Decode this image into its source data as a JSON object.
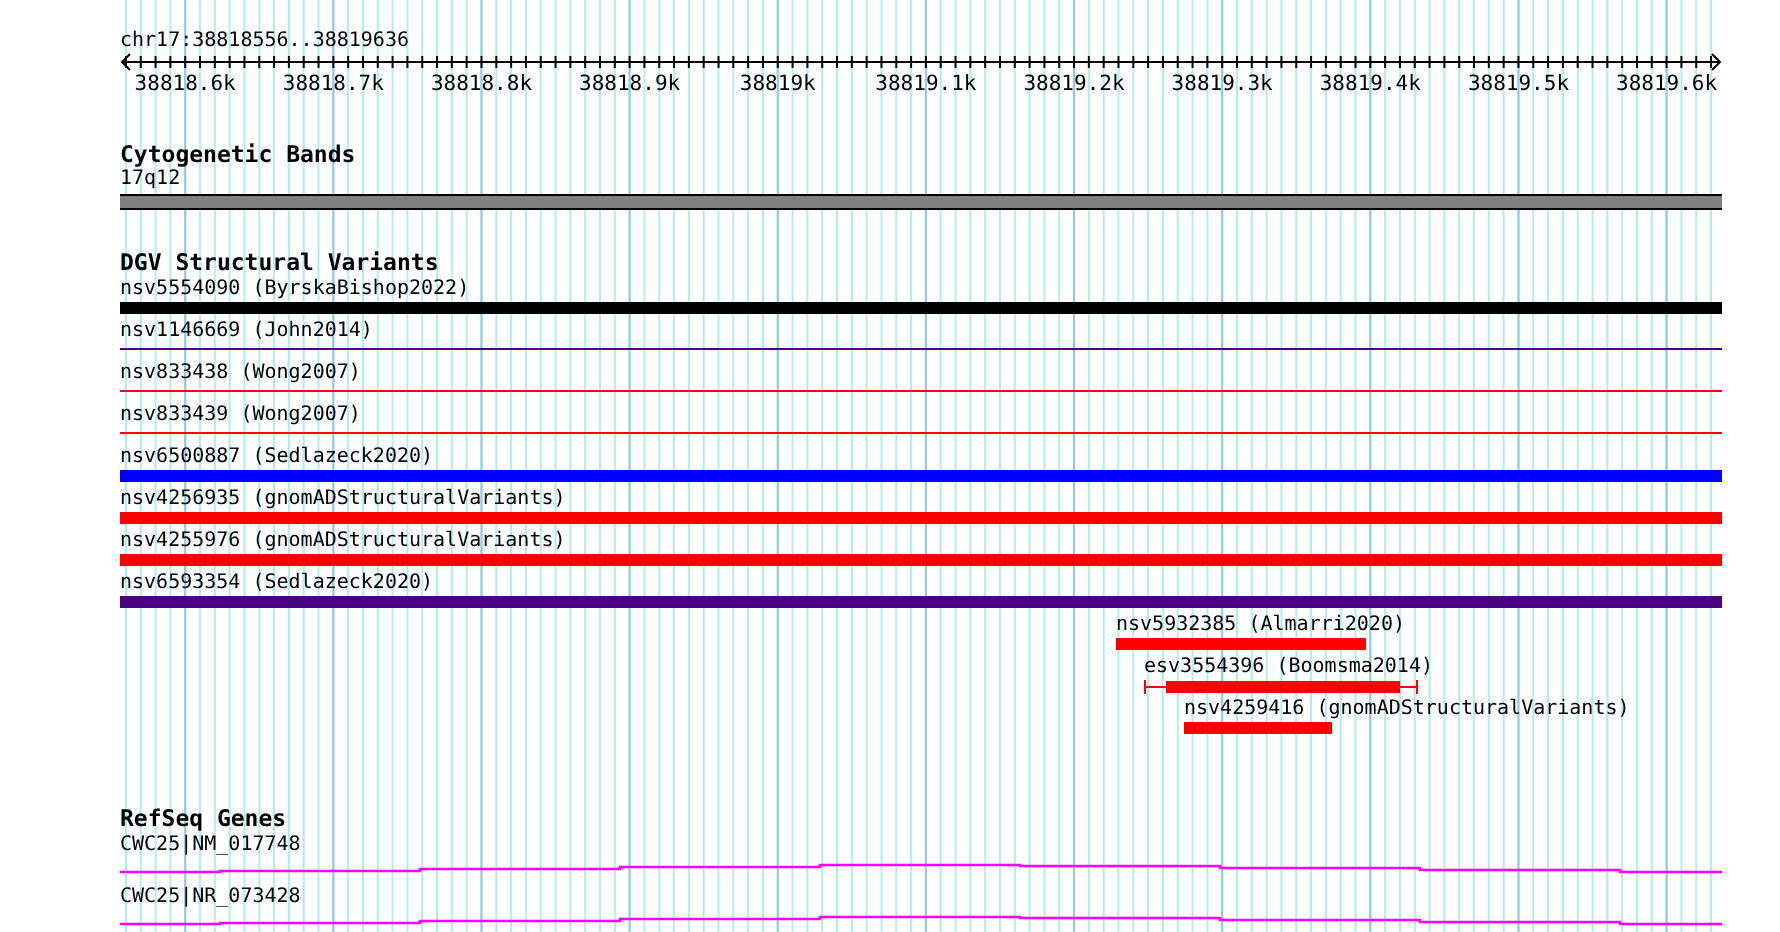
{
  "ruler": {
    "location": "chr17:38818556..38819636",
    "ticks": [
      "38818.6k",
      "38818.7k",
      "38818.8k",
      "38818.9k",
      "38819k",
      "38819.1k",
      "38819.2k",
      "38819.3k",
      "38819.4k",
      "38819.5k",
      "38819.6k"
    ]
  },
  "tracks": [
    {
      "title": "Cytogenetic Bands",
      "kind": "bands",
      "features": [
        {
          "label": "17q12"
        }
      ]
    },
    {
      "title": "DGV Structural Variants",
      "kind": "variants",
      "features": [
        {
          "label": "nsv5554090 (ByrskaBishop2022)",
          "color": "#000000",
          "kind": "bar"
        },
        {
          "label": "nsv1146669 (John2014)",
          "color": "#4b0082",
          "kind": "line"
        },
        {
          "label": "nsv833438 (Wong2007)",
          "color": "#ff0000",
          "kind": "line"
        },
        {
          "label": "nsv833439 (Wong2007)",
          "color": "#ff0000",
          "kind": "line"
        },
        {
          "label": "nsv6500887 (Sedlazeck2020)",
          "color": "#0000ff",
          "kind": "bar"
        },
        {
          "label": "nsv4256935 (gnomADStructuralVariants)",
          "color": "#ff0000",
          "kind": "bar"
        },
        {
          "label": "nsv4255976 (gnomADStructuralVariants)",
          "color": "#ff0000",
          "kind": "bar"
        },
        {
          "label": "nsv6593354 (Sedlazeck2020)",
          "color": "#4b0082",
          "kind": "bar"
        },
        {
          "label": "nsv5932385 (Almarri2020)",
          "color": "#ff0000",
          "kind": "bar"
        },
        {
          "label": "esv3554396 (Boomsma2014)",
          "color": "#ff0000",
          "kind": "whisker"
        },
        {
          "label": "nsv4259416 (gnomADStructuralVariants)",
          "color": "#ff0000",
          "kind": "bar"
        }
      ]
    },
    {
      "title": "RefSeq Genes",
      "kind": "genes",
      "features": [
        {
          "label": "CWC25|NM_017748"
        },
        {
          "label": "CWC25|NR_073428"
        }
      ]
    }
  ]
}
